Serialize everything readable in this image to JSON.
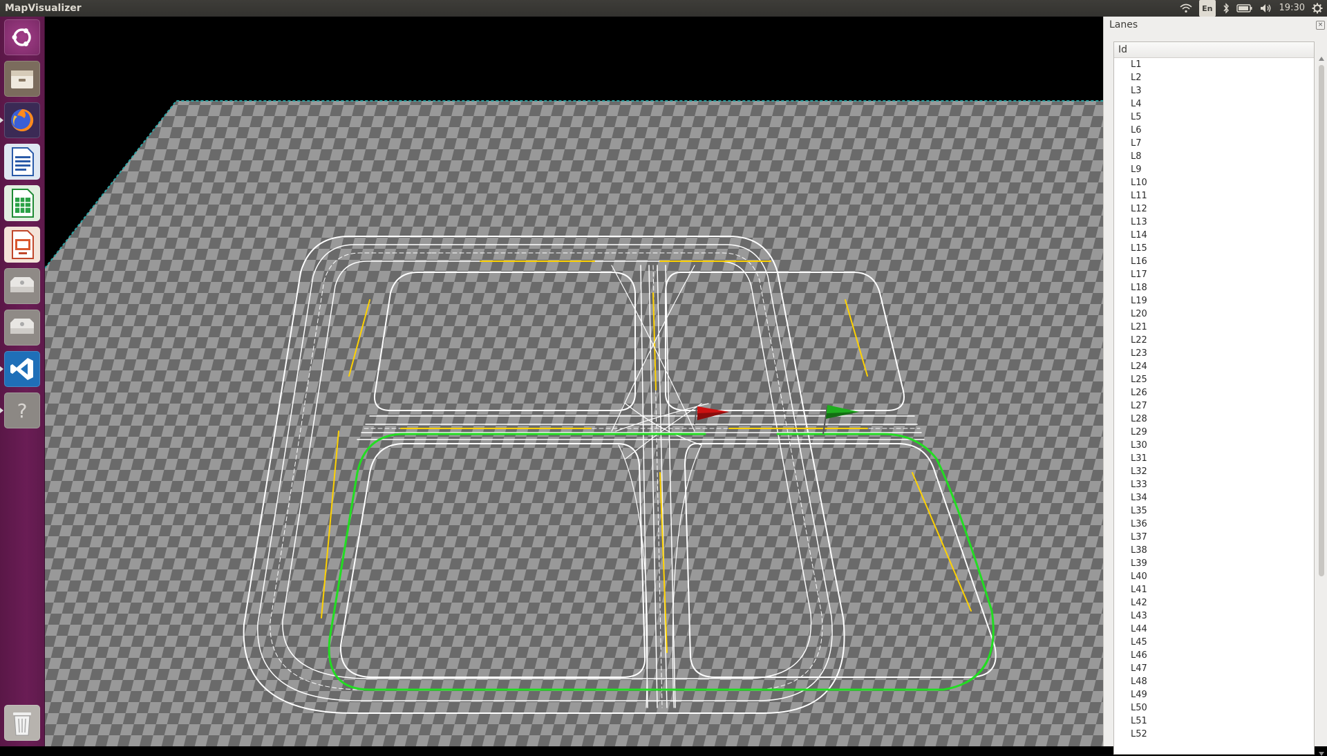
{
  "topbar": {
    "title": "MapVisualizer",
    "keyboard_layout": "En",
    "clock": "19:30"
  },
  "launcher": {
    "items": [
      {
        "name": "ubuntu-dash-icon"
      },
      {
        "name": "files-icon"
      },
      {
        "name": "firefox-icon"
      },
      {
        "name": "libreoffice-writer-icon"
      },
      {
        "name": "libreoffice-calc-icon"
      },
      {
        "name": "libreoffice-impress-icon"
      },
      {
        "name": "drive-icon"
      },
      {
        "name": "drive-icon"
      },
      {
        "name": "vscode-icon"
      },
      {
        "name": "unknown-app-icon"
      }
    ],
    "trash": {
      "name": "trash-icon"
    }
  },
  "viewport": {
    "colors": {
      "lane_boundary": "#ffffff",
      "lane_center": "#ffd200",
      "route": "#22dd22",
      "start_flag": "#cc1111",
      "goal_flag": "#1a9a1a"
    },
    "icons": [
      "red-start-flag",
      "green-goal-flag"
    ]
  },
  "lanes_panel": {
    "title": "Lanes",
    "column_header": "Id",
    "items": [
      "L1",
      "L2",
      "L3",
      "L4",
      "L5",
      "L6",
      "L7",
      "L8",
      "L9",
      "L10",
      "L11",
      "L12",
      "L13",
      "L14",
      "L15",
      "L16",
      "L17",
      "L18",
      "L19",
      "L20",
      "L21",
      "L22",
      "L23",
      "L24",
      "L25",
      "L26",
      "L27",
      "L28",
      "L29",
      "L30",
      "L31",
      "L32",
      "L33",
      "L34",
      "L35",
      "L36",
      "L37",
      "L38",
      "L39",
      "L40",
      "L41",
      "L42",
      "L43",
      "L44",
      "L45",
      "L46",
      "L47",
      "L48",
      "L49",
      "L50",
      "L51",
      "L52"
    ]
  }
}
